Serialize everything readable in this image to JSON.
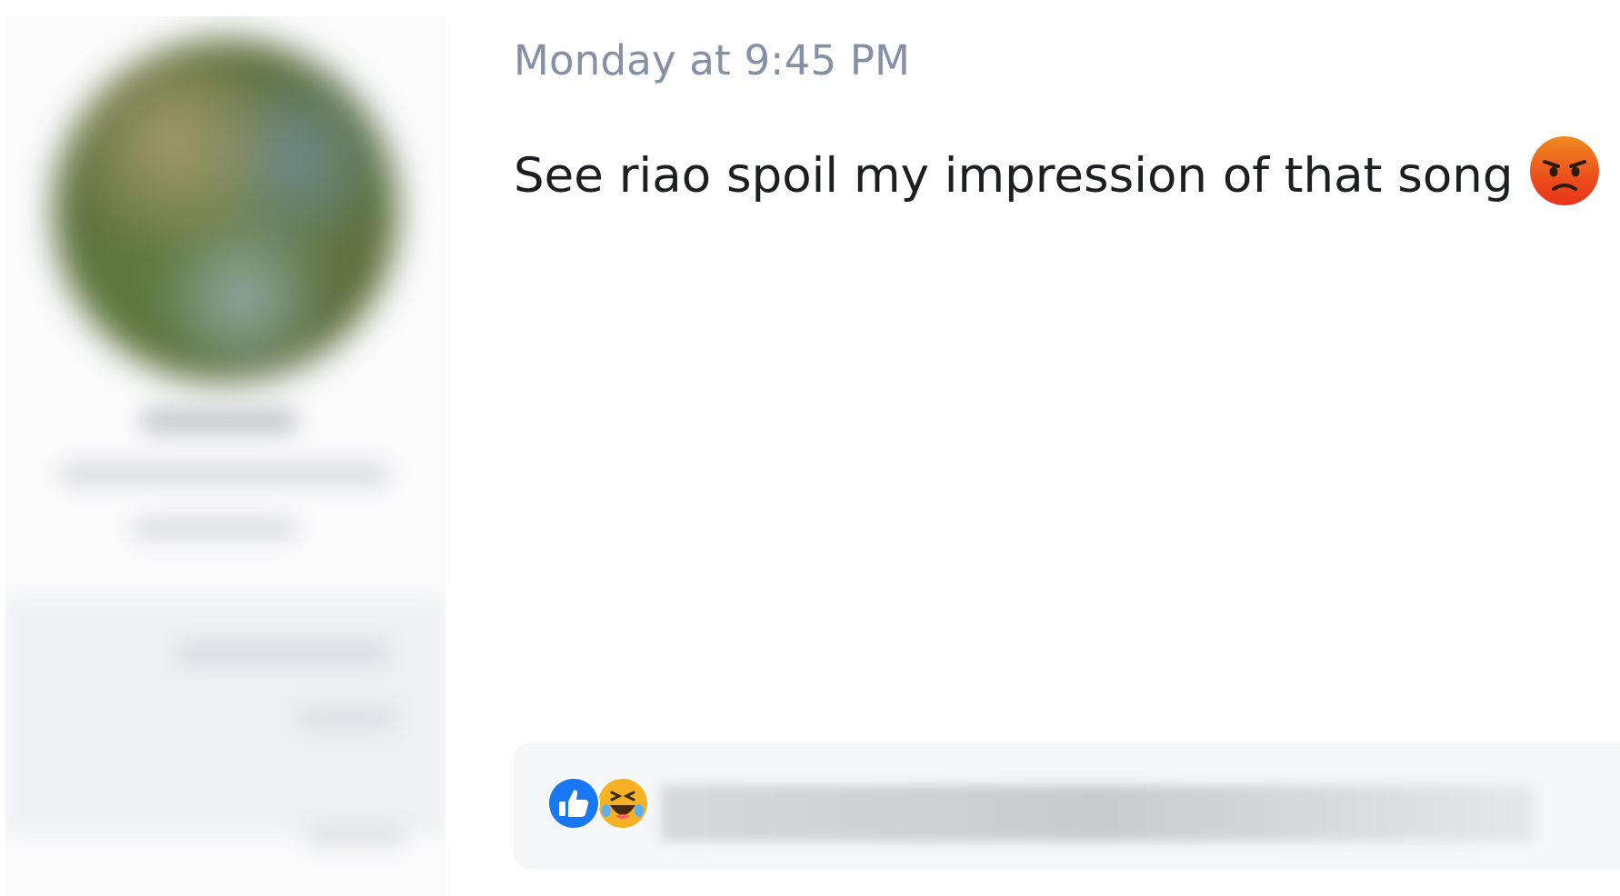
{
  "message": {
    "timestamp": "Monday at 9:45 PM",
    "text": "See riao spoil my impression of that song",
    "emoji_icon": "angry-face-icon"
  },
  "reactions": {
    "icons": [
      "like-icon",
      "haha-icon"
    ],
    "names_redacted": true
  },
  "profile": {
    "redacted": true
  },
  "colors": {
    "timestamp": "#8390a6",
    "message_text": "#1c1e21",
    "like_blue": "#1877f2",
    "haha_yellow": "#f7b125",
    "angry_red": "#e9710f",
    "reaction_bar_bg": "#f5f6f7"
  }
}
